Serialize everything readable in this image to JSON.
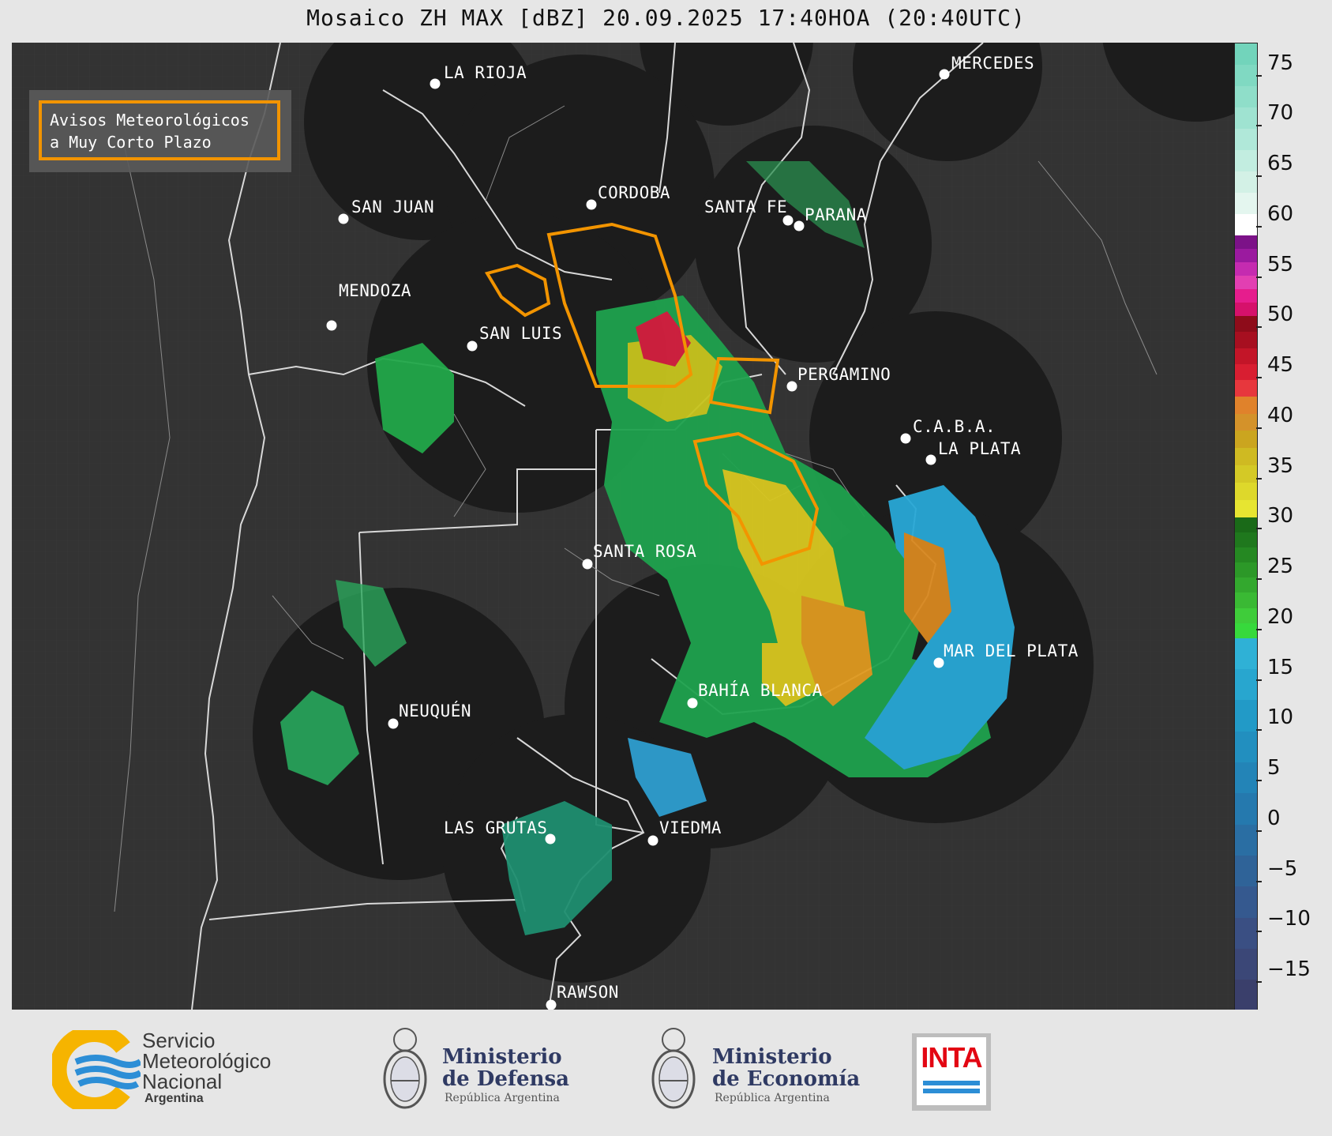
{
  "title": "Mosaico ZH MAX [dBZ] 20.09.2025 17:40HOA (20:40UTC)",
  "legend": {
    "line1": "Avisos Meteorológicos",
    "line2": "a Muy Corto Plazo",
    "color": "#f29400"
  },
  "colorbar": {
    "unit": "dBZ",
    "ticks": [
      "75",
      "70",
      "65",
      "60",
      "55",
      "50",
      "45",
      "40",
      "35",
      "30",
      "25",
      "20",
      "15",
      "10",
      "5",
      "0",
      "−5",
      "−10",
      "−15"
    ]
  },
  "cities": [
    {
      "name": "LA RIOJA"
    },
    {
      "name": "MERCEDES"
    },
    {
      "name": "SAN JUAN"
    },
    {
      "name": "CORDOBA"
    },
    {
      "name": "SANTA FE"
    },
    {
      "name": "PARANA"
    },
    {
      "name": "MENDOZA"
    },
    {
      "name": "SAN LUIS"
    },
    {
      "name": "PERGAMINO"
    },
    {
      "name": "C.A.B.A."
    },
    {
      "name": "LA PLATA"
    },
    {
      "name": "SANTA ROSA"
    },
    {
      "name": "MAR DEL PLATA"
    },
    {
      "name": "BAHÍA BLANCA"
    },
    {
      "name": "NEUQUÉN"
    },
    {
      "name": "LAS GRUTAS"
    },
    {
      "name": "VIEDMA"
    },
    {
      "name": "RAWSON"
    }
  ],
  "footer": {
    "smn": {
      "line1": "Servicio",
      "line2": "Meteorológico",
      "line3": "Nacional",
      "country": "Argentina"
    },
    "defensa": {
      "line1": "Ministerio",
      "line2": "de Defensa",
      "sub": "República Argentina"
    },
    "economia": {
      "line1": "Ministerio",
      "line2": "de Economía",
      "sub": "República Argentina"
    },
    "inta": {
      "label": "INTA"
    }
  }
}
